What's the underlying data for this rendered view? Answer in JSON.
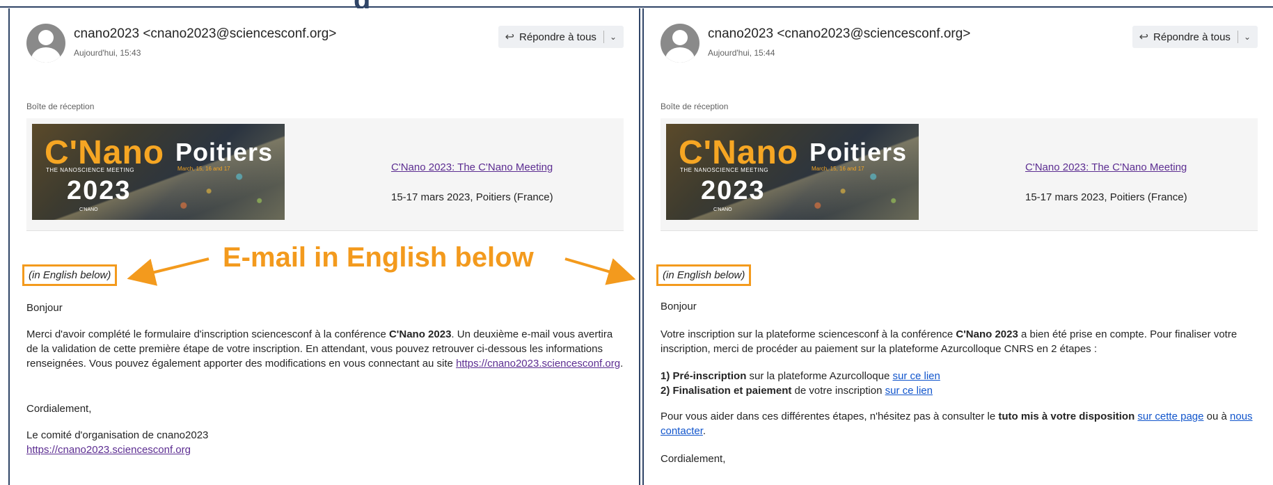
{
  "left": {
    "sender": "cnano2023 <cnano2023@sciencesconf.org>",
    "time": "Aujourd'hui, 15:43",
    "reply_label": "Répondre à tous",
    "folder": "Boîte de réception",
    "banner": {
      "brand": "C'Nano",
      "tagline": "THE NANOSCIENCE MEETING",
      "city": "Poitiers",
      "dates": "March, 15, 16 and 17",
      "year": "2023",
      "logo": "C'NANO"
    },
    "conf_link": "C'Nano 2023: The C'Nano Meeting",
    "conf_dates": "15-17 mars 2023, Poitiers (France)",
    "in_english": "(in English below)",
    "greeting": "Bonjour",
    "p1_a": "Merci d'avoir complété le formulaire d'inscription sciencesconf à la conférence ",
    "p1_bold": "C'Nano 2023",
    "p1_b": ". Un deuxième e-mail vous avertira de la validation de cette première étape de votre inscription. En attendant, vous pouvez retrouver ci-dessous les informations renseignées. Vous pouvez également apporter des modifications en vous connectant au site ",
    "p1_link": "https://cnano2023.sciencesconf.org",
    "p1_end": ".",
    "closing": "Cordialement,",
    "signature": "Le comité d'organisation de cnano2023",
    "sig_link": "https://cnano2023.sciencesconf.org"
  },
  "right": {
    "sender": "cnano2023 <cnano2023@sciencesconf.org>",
    "time": "Aujourd'hui, 15:44",
    "reply_label": "Répondre à tous",
    "folder": "Boîte de réception",
    "banner": {
      "brand": "C'Nano",
      "tagline": "THE NANOSCIENCE MEETING",
      "city": "Poitiers",
      "dates": "March, 15, 16 and 17",
      "year": "2023",
      "logo": "C'NANO"
    },
    "conf_link": "C'Nano 2023: The C'Nano Meeting",
    "conf_dates": "15-17 mars 2023, Poitiers (France)",
    "in_english": "(in English below)",
    "greeting": "Bonjour",
    "p1_a": "Votre inscription sur la plateforme sciencesconf à la conférence ",
    "p1_bold": "C'Nano 2023",
    "p1_b": " a bien été prise en compte. Pour finaliser votre inscription, merci de procéder au paiement sur la plateforme Azurcolloque CNRS en 2 étapes :",
    "step1_bold": "1) Pré-inscription",
    "step1_text": " sur la plateforme Azurcolloque ",
    "step1_link": "sur ce lien",
    "step2_bold": "2) Finalisation et paiement",
    "step2_text": " de votre inscription ",
    "step2_link": "sur ce lien",
    "p2_a": "Pour vous aider dans ces différentes étapes, n'hésitez pas à consulter le ",
    "p2_bold": "tuto mis à votre disposition",
    "p2_b": " ",
    "p2_link1": "sur cette page",
    "p2_c": " ou à ",
    "p2_link2": "nous contacter",
    "p2_end": ".",
    "closing": "Cordialement,"
  },
  "annotation": {
    "title": "E-mail in English below",
    "color": "#f39a1d"
  },
  "colors": {
    "frame": "#2f4466",
    "link": "#1155cc",
    "visited_link": "#5c2d91",
    "accent": "#f39a1d"
  }
}
